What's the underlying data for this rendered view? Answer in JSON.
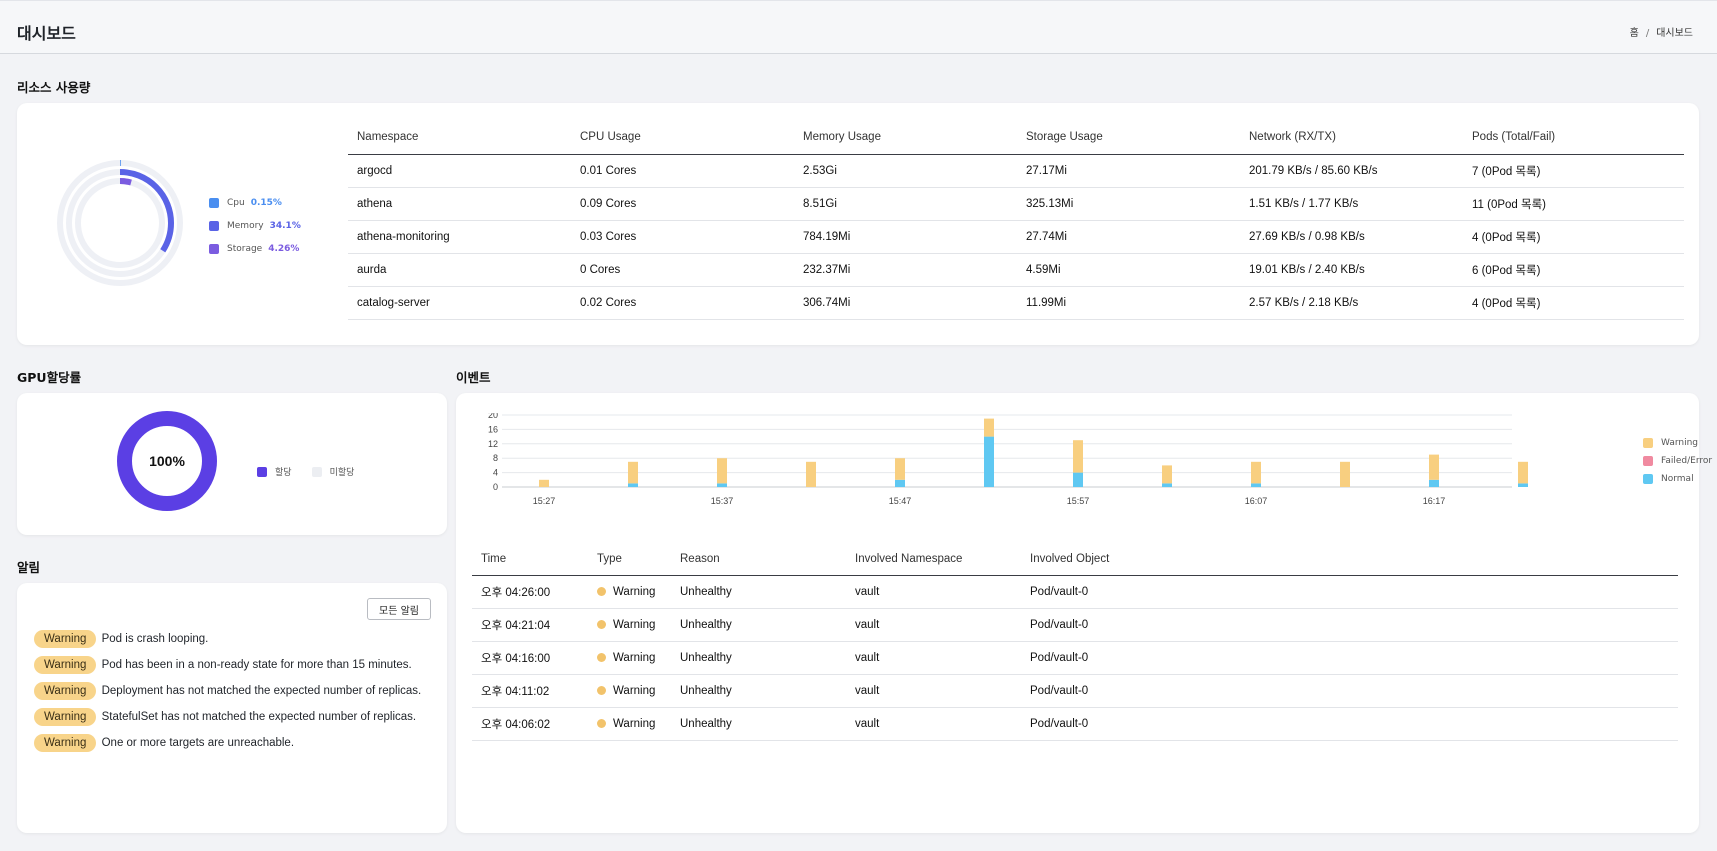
{
  "header": {
    "title": "대시보드",
    "breadcrumb": [
      "홈",
      "/",
      "대시보드"
    ]
  },
  "resource_section": {
    "title": "리소스 사용량",
    "legend": [
      {
        "label": "Cpu",
        "value": "0.15%",
        "color": "#4a8ef0",
        "percent": 0.15
      },
      {
        "label": "Memory",
        "value": "34.1%",
        "color": "#5a63e6",
        "percent": 34.1
      },
      {
        "label": "Storage",
        "value": "4.26%",
        "color": "#7b5ce0",
        "percent": 4.26
      }
    ],
    "columns": [
      "Namespace",
      "CPU Usage",
      "Memory Usage",
      "Storage Usage",
      "Network (RX/TX)",
      "Pods (Total/Fail)"
    ],
    "rows": [
      [
        "argocd",
        "0.01 Cores",
        "2.53Gi",
        "27.17Mi",
        "201.79 KB/s / 85.60 KB/s",
        "7 (0Pod 목록)"
      ],
      [
        "athena",
        "0.09 Cores",
        "8.51Gi",
        "325.13Mi",
        "1.51 KB/s / 1.77 KB/s",
        "11 (0Pod 목록)"
      ],
      [
        "athena-monitoring",
        "0.03 Cores",
        "784.19Mi",
        "27.74Mi",
        "27.69 KB/s / 0.98 KB/s",
        "4 (0Pod 목록)"
      ],
      [
        "aurda",
        "0 Cores",
        "232.37Mi",
        "4.59Mi",
        "19.01 KB/s / 2.40 KB/s",
        "6 (0Pod 목록)"
      ],
      [
        "catalog-server",
        "0.02 Cores",
        "306.74Mi",
        "11.99Mi",
        "2.57 KB/s / 2.18 KB/s",
        "4 (0Pod 목록)"
      ]
    ]
  },
  "gpu_section": {
    "title": "GPU할당률",
    "center_label": "100%",
    "allocated_percent": 100,
    "legend": [
      {
        "label": "할당",
        "color": "#5b3fe4"
      },
      {
        "label": "미할당",
        "color": "#eceef2"
      }
    ]
  },
  "alerts_section": {
    "title": "알림",
    "all_button": "모든 알림",
    "items": [
      {
        "badge": "Warning",
        "text": "Pod is crash looping."
      },
      {
        "badge": "Warning",
        "text": "Pod has been in a non-ready state for more than 15 minutes."
      },
      {
        "badge": "Warning",
        "text": "Deployment has not matched the expected number of replicas."
      },
      {
        "badge": "Warning",
        "text": "StatefulSet has not matched the expected number of replicas."
      },
      {
        "badge": "Warning",
        "text": "One or more targets are unreachable."
      }
    ]
  },
  "events_section": {
    "title": "이벤트",
    "columns": [
      "Time",
      "Type",
      "Reason",
      "Involved Namespace",
      "Involved Object"
    ],
    "rows": [
      {
        "time": "오후 04:26:00",
        "type": "Warning",
        "reason": "Unhealthy",
        "namespace": "vault",
        "object": "Pod/vault-0"
      },
      {
        "time": "오후 04:21:04",
        "type": "Warning",
        "reason": "Unhealthy",
        "namespace": "vault",
        "object": "Pod/vault-0"
      },
      {
        "time": "오후 04:16:00",
        "type": "Warning",
        "reason": "Unhealthy",
        "namespace": "vault",
        "object": "Pod/vault-0"
      },
      {
        "time": "오후 04:11:02",
        "type": "Warning",
        "reason": "Unhealthy",
        "namespace": "vault",
        "object": "Pod/vault-0"
      },
      {
        "time": "오후 04:06:02",
        "type": "Warning",
        "reason": "Unhealthy",
        "namespace": "vault",
        "object": "Pod/vault-0"
      }
    ]
  },
  "chart_data": {
    "type": "bar",
    "stacked": true,
    "x_ticks": [
      "15:27",
      "15:37",
      "15:47",
      "15:57",
      "16:07",
      "16:17"
    ],
    "y_ticks": [
      0,
      4,
      8,
      12,
      16,
      20
    ],
    "ylim": [
      0,
      20
    ],
    "categories": [
      "15:27",
      "15:32",
      "15:37",
      "15:42",
      "15:47",
      "15:52",
      "15:57",
      "16:02",
      "16:07",
      "16:12",
      "16:17",
      "16:22"
    ],
    "series": [
      {
        "name": "Warning",
        "color": "#f8cf80",
        "values": [
          2,
          6,
          7,
          7,
          6,
          5,
          9,
          5,
          6,
          7,
          7,
          6
        ]
      },
      {
        "name": "Failed/Error",
        "color": "#f08aa0",
        "values": [
          0,
          0,
          0,
          0,
          0,
          0,
          0,
          0,
          0,
          0,
          0,
          0
        ]
      },
      {
        "name": "Normal",
        "color": "#5fc8f2",
        "values": [
          0,
          1,
          1,
          0,
          2,
          14,
          4,
          1,
          1,
          0,
          2,
          1
        ]
      }
    ],
    "legend_position": "right",
    "grid": true
  }
}
